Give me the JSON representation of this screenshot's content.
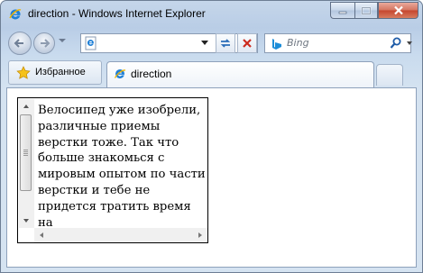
{
  "window": {
    "title": "direction - Windows Internet Explorer",
    "controls": [
      "minimize-icon",
      "maximize-icon",
      "close-icon"
    ]
  },
  "navigation": {
    "address_value": "",
    "search_placeholder": "Bing"
  },
  "tabs": {
    "favorites_label": "Избранное",
    "active_tab_label": "direction"
  },
  "page": {
    "box_text": "Велосипед уже изобрели, различные приемы верстки тоже. Так что больше знакомься с мировым опытом по части верстки и тебе не придется тратить время на"
  },
  "colors": {
    "chrome": "#c5d6ea",
    "close_button": "#c5452d"
  }
}
